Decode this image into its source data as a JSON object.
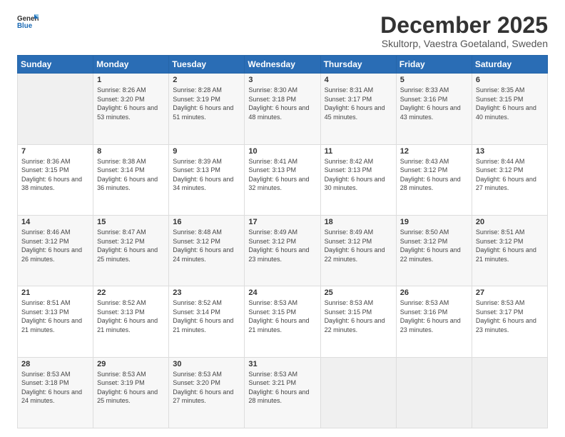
{
  "logo": {
    "line1": "General",
    "line2": "Blue"
  },
  "header": {
    "month": "December 2025",
    "location": "Skultorp, Vaestra Goetaland, Sweden"
  },
  "weekdays": [
    "Sunday",
    "Monday",
    "Tuesday",
    "Wednesday",
    "Thursday",
    "Friday",
    "Saturday"
  ],
  "weeks": [
    [
      {
        "day": "",
        "sunrise": "",
        "sunset": "",
        "daylight": ""
      },
      {
        "day": "1",
        "sunrise": "Sunrise: 8:26 AM",
        "sunset": "Sunset: 3:20 PM",
        "daylight": "Daylight: 6 hours and 53 minutes."
      },
      {
        "day": "2",
        "sunrise": "Sunrise: 8:28 AM",
        "sunset": "Sunset: 3:19 PM",
        "daylight": "Daylight: 6 hours and 51 minutes."
      },
      {
        "day": "3",
        "sunrise": "Sunrise: 8:30 AM",
        "sunset": "Sunset: 3:18 PM",
        "daylight": "Daylight: 6 hours and 48 minutes."
      },
      {
        "day": "4",
        "sunrise": "Sunrise: 8:31 AM",
        "sunset": "Sunset: 3:17 PM",
        "daylight": "Daylight: 6 hours and 45 minutes."
      },
      {
        "day": "5",
        "sunrise": "Sunrise: 8:33 AM",
        "sunset": "Sunset: 3:16 PM",
        "daylight": "Daylight: 6 hours and 43 minutes."
      },
      {
        "day": "6",
        "sunrise": "Sunrise: 8:35 AM",
        "sunset": "Sunset: 3:15 PM",
        "daylight": "Daylight: 6 hours and 40 minutes."
      }
    ],
    [
      {
        "day": "7",
        "sunrise": "Sunrise: 8:36 AM",
        "sunset": "Sunset: 3:15 PM",
        "daylight": "Daylight: 6 hours and 38 minutes."
      },
      {
        "day": "8",
        "sunrise": "Sunrise: 8:38 AM",
        "sunset": "Sunset: 3:14 PM",
        "daylight": "Daylight: 6 hours and 36 minutes."
      },
      {
        "day": "9",
        "sunrise": "Sunrise: 8:39 AM",
        "sunset": "Sunset: 3:13 PM",
        "daylight": "Daylight: 6 hours and 34 minutes."
      },
      {
        "day": "10",
        "sunrise": "Sunrise: 8:41 AM",
        "sunset": "Sunset: 3:13 PM",
        "daylight": "Daylight: 6 hours and 32 minutes."
      },
      {
        "day": "11",
        "sunrise": "Sunrise: 8:42 AM",
        "sunset": "Sunset: 3:13 PM",
        "daylight": "Daylight: 6 hours and 30 minutes."
      },
      {
        "day": "12",
        "sunrise": "Sunrise: 8:43 AM",
        "sunset": "Sunset: 3:12 PM",
        "daylight": "Daylight: 6 hours and 28 minutes."
      },
      {
        "day": "13",
        "sunrise": "Sunrise: 8:44 AM",
        "sunset": "Sunset: 3:12 PM",
        "daylight": "Daylight: 6 hours and 27 minutes."
      }
    ],
    [
      {
        "day": "14",
        "sunrise": "Sunrise: 8:46 AM",
        "sunset": "Sunset: 3:12 PM",
        "daylight": "Daylight: 6 hours and 26 minutes."
      },
      {
        "day": "15",
        "sunrise": "Sunrise: 8:47 AM",
        "sunset": "Sunset: 3:12 PM",
        "daylight": "Daylight: 6 hours and 25 minutes."
      },
      {
        "day": "16",
        "sunrise": "Sunrise: 8:48 AM",
        "sunset": "Sunset: 3:12 PM",
        "daylight": "Daylight: 6 hours and 24 minutes."
      },
      {
        "day": "17",
        "sunrise": "Sunrise: 8:49 AM",
        "sunset": "Sunset: 3:12 PM",
        "daylight": "Daylight: 6 hours and 23 minutes."
      },
      {
        "day": "18",
        "sunrise": "Sunrise: 8:49 AM",
        "sunset": "Sunset: 3:12 PM",
        "daylight": "Daylight: 6 hours and 22 minutes."
      },
      {
        "day": "19",
        "sunrise": "Sunrise: 8:50 AM",
        "sunset": "Sunset: 3:12 PM",
        "daylight": "Daylight: 6 hours and 22 minutes."
      },
      {
        "day": "20",
        "sunrise": "Sunrise: 8:51 AM",
        "sunset": "Sunset: 3:12 PM",
        "daylight": "Daylight: 6 hours and 21 minutes."
      }
    ],
    [
      {
        "day": "21",
        "sunrise": "Sunrise: 8:51 AM",
        "sunset": "Sunset: 3:13 PM",
        "daylight": "Daylight: 6 hours and 21 minutes."
      },
      {
        "day": "22",
        "sunrise": "Sunrise: 8:52 AM",
        "sunset": "Sunset: 3:13 PM",
        "daylight": "Daylight: 6 hours and 21 minutes."
      },
      {
        "day": "23",
        "sunrise": "Sunrise: 8:52 AM",
        "sunset": "Sunset: 3:14 PM",
        "daylight": "Daylight: 6 hours and 21 minutes."
      },
      {
        "day": "24",
        "sunrise": "Sunrise: 8:53 AM",
        "sunset": "Sunset: 3:15 PM",
        "daylight": "Daylight: 6 hours and 21 minutes."
      },
      {
        "day": "25",
        "sunrise": "Sunrise: 8:53 AM",
        "sunset": "Sunset: 3:15 PM",
        "daylight": "Daylight: 6 hours and 22 minutes."
      },
      {
        "day": "26",
        "sunrise": "Sunrise: 8:53 AM",
        "sunset": "Sunset: 3:16 PM",
        "daylight": "Daylight: 6 hours and 23 minutes."
      },
      {
        "day": "27",
        "sunrise": "Sunrise: 8:53 AM",
        "sunset": "Sunset: 3:17 PM",
        "daylight": "Daylight: 6 hours and 23 minutes."
      }
    ],
    [
      {
        "day": "28",
        "sunrise": "Sunrise: 8:53 AM",
        "sunset": "Sunset: 3:18 PM",
        "daylight": "Daylight: 6 hours and 24 minutes."
      },
      {
        "day": "29",
        "sunrise": "Sunrise: 8:53 AM",
        "sunset": "Sunset: 3:19 PM",
        "daylight": "Daylight: 6 hours and 25 minutes."
      },
      {
        "day": "30",
        "sunrise": "Sunrise: 8:53 AM",
        "sunset": "Sunset: 3:20 PM",
        "daylight": "Daylight: 6 hours and 27 minutes."
      },
      {
        "day": "31",
        "sunrise": "Sunrise: 8:53 AM",
        "sunset": "Sunset: 3:21 PM",
        "daylight": "Daylight: 6 hours and 28 minutes."
      },
      {
        "day": "",
        "sunrise": "",
        "sunset": "",
        "daylight": ""
      },
      {
        "day": "",
        "sunrise": "",
        "sunset": "",
        "daylight": ""
      },
      {
        "day": "",
        "sunrise": "",
        "sunset": "",
        "daylight": ""
      }
    ]
  ]
}
